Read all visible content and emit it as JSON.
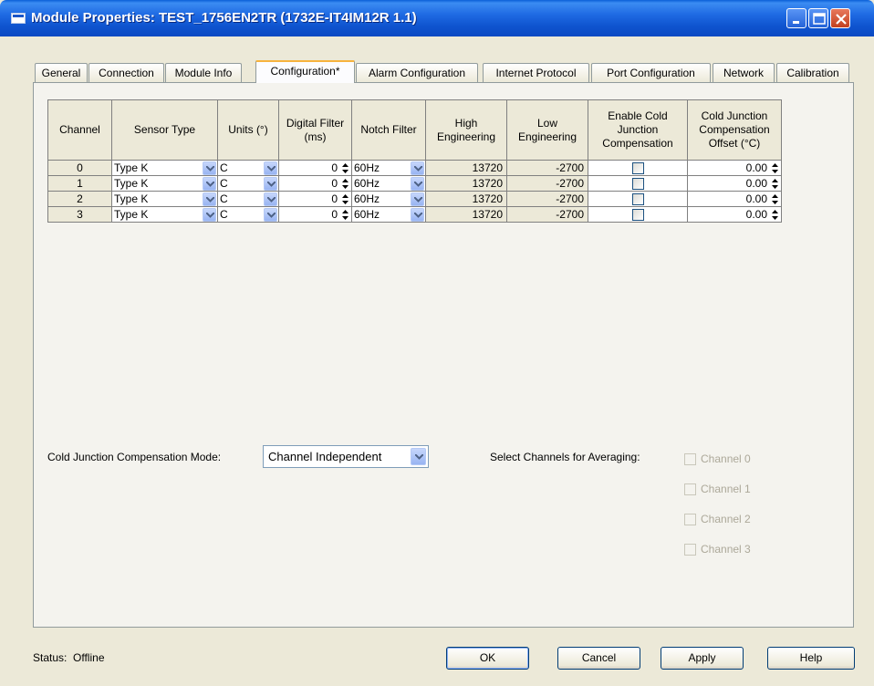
{
  "window": {
    "title": "Module Properties: TEST_1756EN2TR (1732E-IT4IM12R 1.1)",
    "minimize_icon": "minimize-icon",
    "maximize_icon": "maximize-icon",
    "close_icon": "close-icon"
  },
  "tabs": [
    {
      "label": "General"
    },
    {
      "label": "Connection"
    },
    {
      "label": "Module Info"
    },
    {
      "label": "Configuration*",
      "active": true
    },
    {
      "label": "Alarm Configuration"
    },
    {
      "label": "Internet Protocol"
    },
    {
      "label": "Port Configuration"
    },
    {
      "label": "Network"
    },
    {
      "label": "Calibration"
    }
  ],
  "grid": {
    "columns": [
      "Channel",
      "Sensor Type",
      "Units (°)",
      "Digital Filter (ms)",
      "Notch Filter",
      "High Engineering",
      "Low Engineering",
      "Enable Cold Junction Compensation",
      "Cold Junction Compensation Offset (°C)"
    ],
    "rows": [
      {
        "channel": "0",
        "sensor": "Type K",
        "units": "C",
        "filter": "0",
        "notch": "60Hz",
        "high": "13720",
        "low": "-2700",
        "cjc": false,
        "offset": "0.00"
      },
      {
        "channel": "1",
        "sensor": "Type K",
        "units": "C",
        "filter": "0",
        "notch": "60Hz",
        "high": "13720",
        "low": "-2700",
        "cjc": false,
        "offset": "0.00"
      },
      {
        "channel": "2",
        "sensor": "Type K",
        "units": "C",
        "filter": "0",
        "notch": "60Hz",
        "high": "13720",
        "low": "-2700",
        "cjc": false,
        "offset": "0.00"
      },
      {
        "channel": "3",
        "sensor": "Type K",
        "units": "C",
        "filter": "0",
        "notch": "60Hz",
        "high": "13720",
        "low": "-2700",
        "cjc": false,
        "offset": "0.00"
      }
    ]
  },
  "cjc_mode": {
    "label": "Cold Junction Compensation Mode:",
    "value": "Channel Independent"
  },
  "averaging": {
    "label": "Select Channels for Averaging:",
    "options": [
      "Channel 0",
      "Channel 1",
      "Channel 2",
      "Channel 3"
    ]
  },
  "status": {
    "text": "Status:  Offline"
  },
  "buttons": {
    "ok": "OK",
    "cancel": "Cancel",
    "apply": "Apply",
    "help": "Help"
  },
  "colors": {
    "titlebar": "#0a49c2",
    "active_tab_accent": "#f7b33d",
    "window_bg": "#ece9d8"
  }
}
